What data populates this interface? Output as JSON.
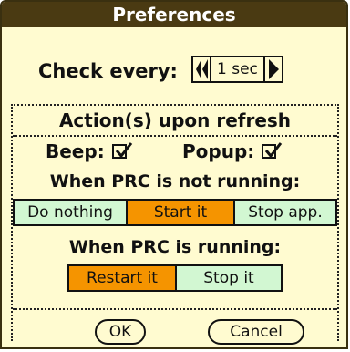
{
  "title": "Preferences",
  "check_every": {
    "label": "Check every:",
    "value": "1 sec"
  },
  "actions": {
    "header": "Action(s) upon refresh",
    "beep_label": "Beep:",
    "beep_checked": true,
    "popup_label": "Popup:",
    "popup_checked": true
  },
  "not_running": {
    "header": "When PRC is not running:",
    "options": [
      "Do nothing",
      "Start it",
      "Stop app."
    ],
    "selected": "Start it"
  },
  "running": {
    "header": "When PRC is running:",
    "options": [
      "Restart it",
      "Stop it"
    ],
    "selected": "Restart it"
  },
  "buttons": {
    "ok": "OK",
    "cancel": "Cancel"
  },
  "colors": {
    "titlebar": "#4a3a12",
    "background": "#fffbd0",
    "selected": "#f59400",
    "unselected": "#d2f7d2"
  }
}
